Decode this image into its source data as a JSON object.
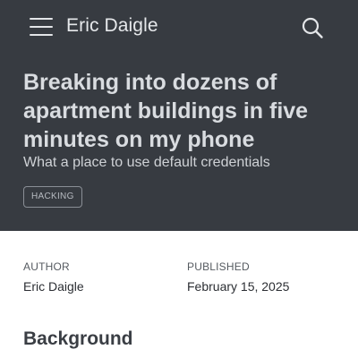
{
  "header": {
    "site_title": "Eric Daigle",
    "menu_icon": "hamburger-menu-icon",
    "search_icon": "search-icon"
  },
  "post": {
    "title": "Breaking into dozens of apartment buildings in five minutes on my phone",
    "subtitle": "What a place to use default credentials",
    "tags": [
      "HACKING"
    ]
  },
  "meta": {
    "author_label": "AUTHOR",
    "author": "Eric Daigle",
    "published_label": "PUBLISHED",
    "published": "February 15, 2025"
  },
  "content": {
    "first_heading": "Background"
  },
  "colors": {
    "hero_background": "#373b41",
    "page_background": "#ffffff"
  }
}
